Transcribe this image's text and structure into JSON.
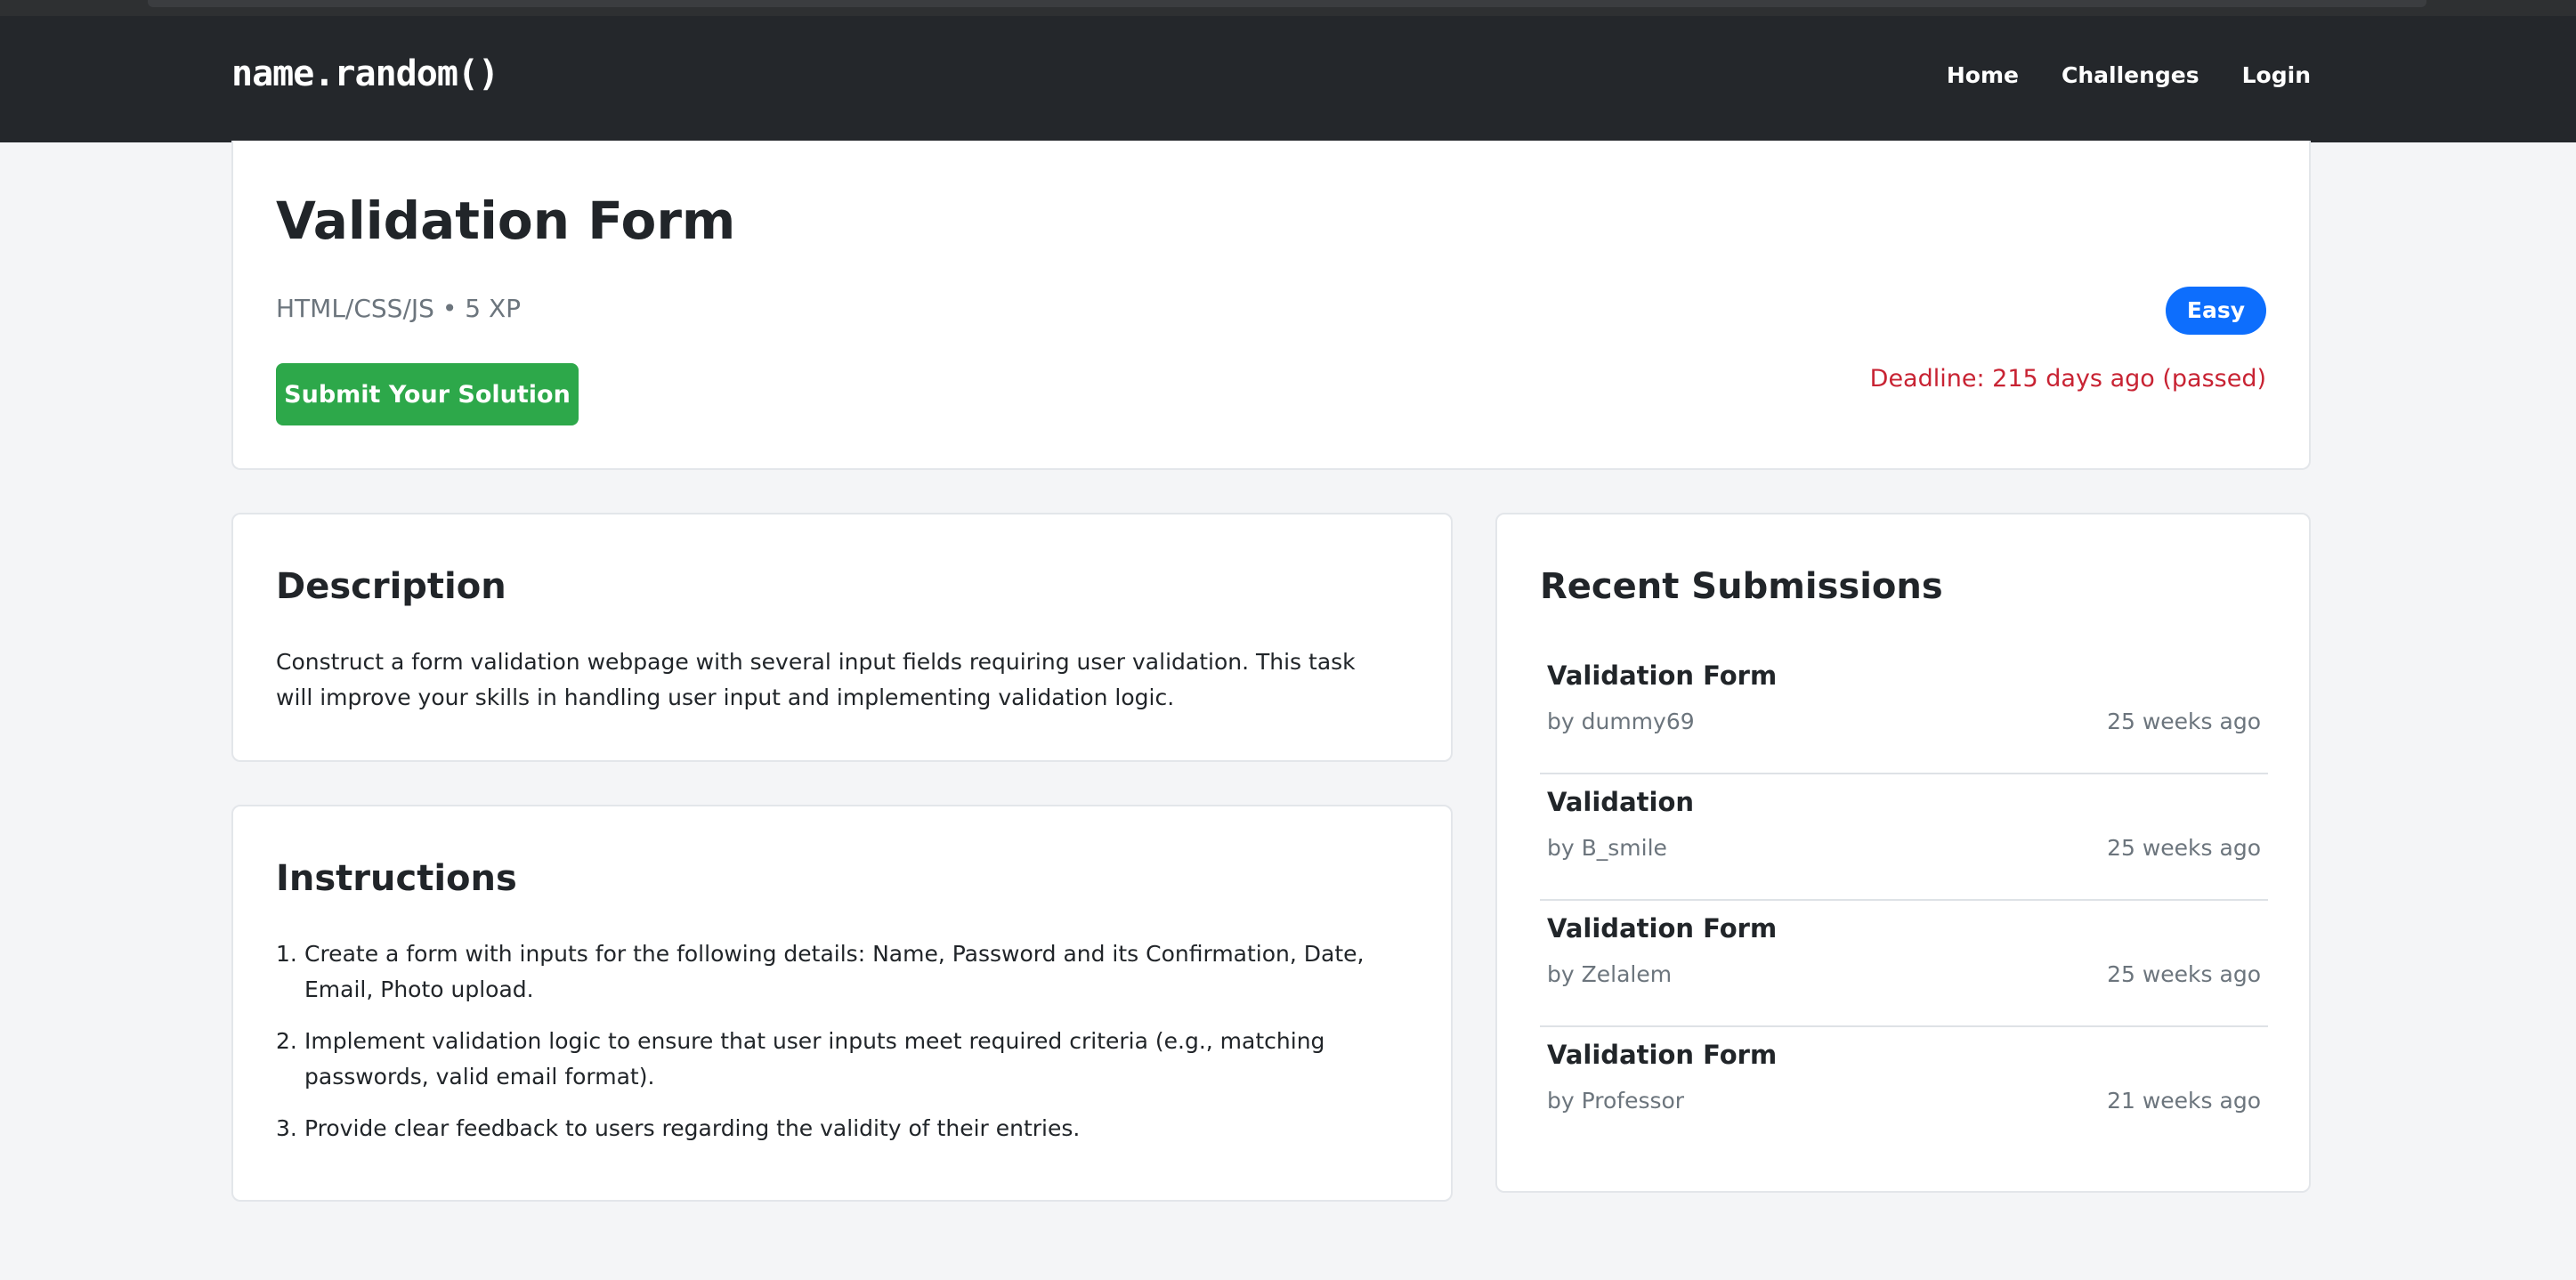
{
  "navbar": {
    "brand": "name.random()",
    "links": [
      "Home",
      "Challenges",
      "Login"
    ]
  },
  "challenge": {
    "title": "Validation Form",
    "meta": "HTML/CSS/JS • 5 XP",
    "submit_label": "Submit Your Solution",
    "difficulty": "Easy",
    "deadline": "Deadline: 215 days ago (passed)"
  },
  "description": {
    "heading": "Description",
    "text": "Construct a form validation webpage with several input fields requiring user validation. This task will improve your skills in handling user input and implementing validation logic."
  },
  "instructions": {
    "heading": "Instructions",
    "items": [
      "Create a form with inputs for the following details: Name, Password and its Confirmation, Date, Email, Photo upload.",
      "Implement validation logic to ensure that user inputs meet required criteria (e.g., matching passwords, valid email format).",
      "Provide clear feedback to users regarding the validity of their entries."
    ]
  },
  "submissions": {
    "heading": "Recent Submissions",
    "items": [
      {
        "title": "Validation Form",
        "author": "by dummy69",
        "time": "25 weeks ago"
      },
      {
        "title": "Validation",
        "author": "by B_smile",
        "time": "25 weeks ago"
      },
      {
        "title": "Validation Form",
        "author": "by Zelalem",
        "time": "25 weeks ago"
      },
      {
        "title": "Validation Form",
        "author": "by Professor",
        "time": "21 weeks ago"
      }
    ]
  },
  "colors": {
    "navbar": "#24272b",
    "submit": "#2da84a",
    "badge": "#0d6efd",
    "deadline": "#c82333"
  }
}
